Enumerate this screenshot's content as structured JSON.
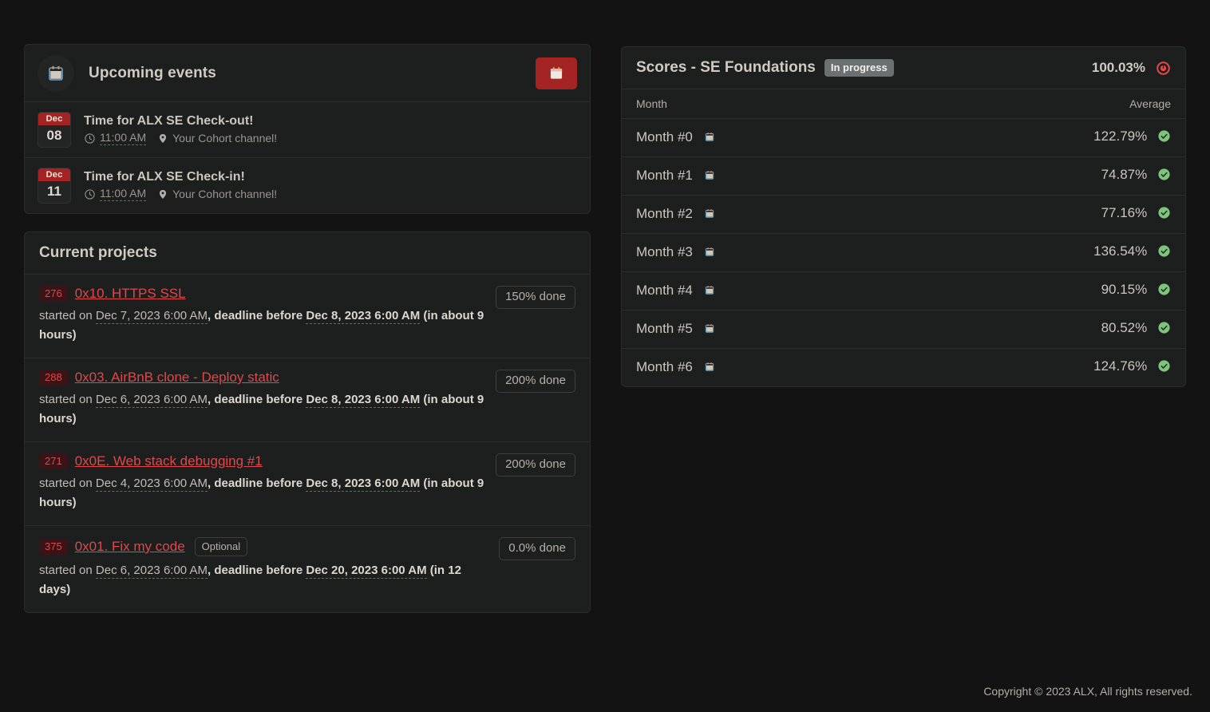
{
  "events_card": {
    "title": "Upcoming events",
    "header_icon": "calendar-icon",
    "action_button_icon": "calendar-icon",
    "accent_color": "#a32422",
    "items": [
      {
        "month": "Dec",
        "day": "08",
        "name": "Time for ALX SE Check-out!",
        "time": "11:00 AM",
        "location": "Your Cohort channel!"
      },
      {
        "month": "Dec",
        "day": "11",
        "name": "Time for ALX SE Check-in!",
        "time": "11:00 AM",
        "location": "Your Cohort channel!"
      }
    ]
  },
  "projects_card": {
    "title": "Current projects",
    "items": [
      {
        "id": "276",
        "name": "0x10. HTTPS SSL",
        "optional": "",
        "done": "150% done",
        "started_prefix": "started on ",
        "started_date": "Dec 7, 2023 6:00 AM",
        "deadline_label": ", deadline before ",
        "deadline_date": "Dec 8, 2023 6:00 AM",
        "remaining": " (in about 9 hours)"
      },
      {
        "id": "288",
        "name": "0x03. AirBnB clone - Deploy static",
        "optional": "",
        "done": "200% done",
        "started_prefix": "started on ",
        "started_date": "Dec 6, 2023 6:00 AM",
        "deadline_label": ", deadline before ",
        "deadline_date": "Dec 8, 2023 6:00 AM",
        "remaining": " (in about 9 hours)"
      },
      {
        "id": "271",
        "name": "0x0E. Web stack debugging #1",
        "optional": "",
        "done": "200% done",
        "started_prefix": "started on ",
        "started_date": "Dec 4, 2023 6:00 AM",
        "deadline_label": ", deadline before ",
        "deadline_date": "Dec 8, 2023 6:00 AM",
        "remaining": " (in about 9 hours)"
      },
      {
        "id": "375",
        "name": "0x01. Fix my code",
        "optional": "Optional",
        "done": "0.0% done",
        "started_prefix": "started on ",
        "started_date": "Dec 6, 2023 6:00 AM",
        "deadline_label": ", deadline before ",
        "deadline_date": "Dec 20, 2023 6:00 AM",
        "remaining": " (in 12 days)"
      }
    ]
  },
  "scores_card": {
    "title": "Scores - SE Foundations",
    "status": "In progress",
    "overall_percent": "100.03%",
    "overall_icon": "clock-circle-icon",
    "columns": {
      "month": "Month",
      "average": "Average"
    },
    "rows": [
      {
        "month": "Month #0",
        "average": "122.79%",
        "icon": "check-circle-icon"
      },
      {
        "month": "Month #1",
        "average": "74.87%",
        "icon": "check-circle-icon"
      },
      {
        "month": "Month #2",
        "average": "77.16%",
        "icon": "check-circle-icon"
      },
      {
        "month": "Month #3",
        "average": "136.54%",
        "icon": "check-circle-icon"
      },
      {
        "month": "Month #4",
        "average": "90.15%",
        "icon": "check-circle-icon"
      },
      {
        "month": "Month #5",
        "average": "80.52%",
        "icon": "check-circle-icon"
      },
      {
        "month": "Month #6",
        "average": "124.76%",
        "icon": "check-circle-icon"
      }
    ]
  },
  "footer": {
    "copyright": "Copyright © 2023 ALX, All rights reserved."
  },
  "colors": {
    "accent_red": "#a32422",
    "link_red": "#e0484a",
    "success_green": "#7dc47f",
    "page_bg": "#131313",
    "card_bg": "#1d1e1e"
  }
}
